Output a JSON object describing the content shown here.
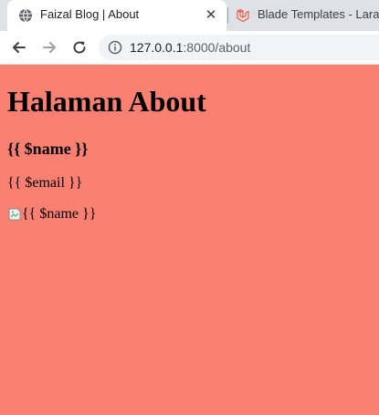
{
  "browser": {
    "tabs": [
      {
        "title": "Faizal Blog | About",
        "favicon": "globe-icon",
        "active": true
      },
      {
        "title": "Blade Templates - Larave",
        "favicon": "laravel-icon",
        "active": false
      }
    ],
    "address": {
      "host": "127.0.0.1",
      "path": ":8000/about"
    }
  },
  "page": {
    "heading": "Halaman About",
    "name_placeholder": "{{ $name }}",
    "email_placeholder": "{{ $email }}",
    "image_alt": "{{ $name }}",
    "background": "#fa8072"
  },
  "colors": {
    "tabstrip": "#dee1e6",
    "laravel": "#f05340"
  }
}
